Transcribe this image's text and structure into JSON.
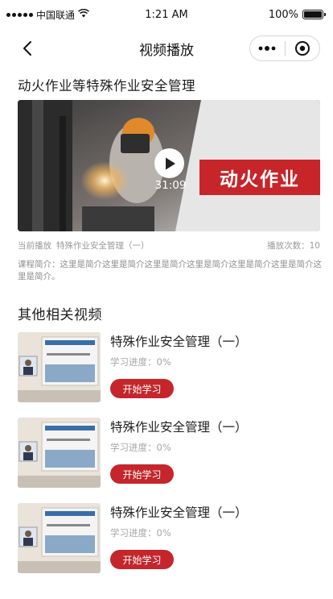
{
  "status_bar": {
    "carrier": "中国联通",
    "time": "1:21 AM",
    "battery": "100%"
  },
  "nav": {
    "title": "视频播放"
  },
  "course": {
    "title": "动火作业等特殊作业安全管理"
  },
  "video": {
    "banner_text": "动火作业",
    "duration": "31:09"
  },
  "meta": {
    "now_playing_label": "当前播放",
    "now_playing_title": "特殊作业安全管理（一）",
    "play_count": "播放次数：10"
  },
  "intro": {
    "text": "课程简介：这里是简介这里是简介这里是简介这里是简介这里是简介这里是简介这里是简介。"
  },
  "related": {
    "title": "其他相关视频",
    "items": [
      {
        "title": "特殊作业安全管理（一）",
        "progress": "学习进度：0%",
        "button": "开始学习"
      },
      {
        "title": "特殊作业安全管理（一）",
        "progress": "学习进度：0%",
        "button": "开始学习"
      },
      {
        "title": "特殊作业安全管理（一）",
        "progress": "学习进度：0%",
        "button": "开始学习"
      }
    ]
  },
  "colors": {
    "accent": "#c4262c",
    "banner": "#c6262a"
  }
}
